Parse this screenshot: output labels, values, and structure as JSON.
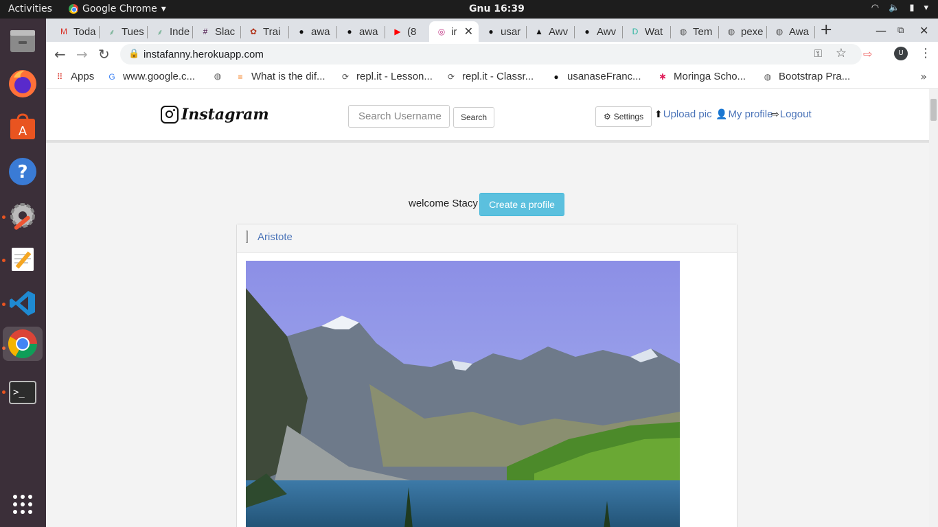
{
  "os": {
    "activities": "Activities",
    "app_name": "Google Chrome",
    "clock": "Gnu 16:39"
  },
  "tabs": [
    {
      "label": "Toda",
      "icon": "gmail-icon",
      "color": "#d93025"
    },
    {
      "label": "Tues",
      "icon": "palm-icon",
      "color": "#6a8"
    },
    {
      "label": "Inde",
      "icon": "palm-icon",
      "color": "#6a8"
    },
    {
      "label": "Slac",
      "icon": "slack-icon",
      "color": "#4a154b"
    },
    {
      "label": "Trai",
      "icon": "codewars-icon",
      "color": "#b1361e"
    },
    {
      "label": "awa",
      "icon": "github-icon",
      "color": "#111"
    },
    {
      "label": "awa",
      "icon": "github-icon",
      "color": "#111"
    },
    {
      "label": "(8",
      "icon": "youtube-icon",
      "color": "#f00"
    },
    {
      "label": "ir",
      "icon": "instagram-icon",
      "color": "#c13584"
    },
    {
      "label": "usar",
      "icon": "github-icon",
      "color": "#111"
    },
    {
      "label": "Awv",
      "icon": "awwwards-icon",
      "color": "#111"
    },
    {
      "label": "Awv",
      "icon": "github-icon",
      "color": "#111"
    },
    {
      "label": "Wat",
      "icon": "dribbble-icon",
      "color": "#2bb5a0"
    },
    {
      "label": "Tem",
      "icon": "globe-icon",
      "color": "#555"
    },
    {
      "label": "pexe",
      "icon": "globe-icon",
      "color": "#555"
    },
    {
      "label": "Awa",
      "icon": "globe-icon",
      "color": "#555"
    }
  ],
  "address": {
    "url": "instafanny.herokuapp.com"
  },
  "bookmarks": [
    {
      "label": "Apps",
      "icon": "apps-grid-icon"
    },
    {
      "label": "www.google.c...",
      "icon": "google-icon"
    },
    {
      "label": "",
      "icon": "globe-icon"
    },
    {
      "label": "What is the dif...",
      "icon": "stackoverflow-icon"
    },
    {
      "label": "repl.it - Lesson...",
      "icon": "replit-icon"
    },
    {
      "label": "repl.it - Classr...",
      "icon": "replit-icon"
    },
    {
      "label": "usanaseFranc...",
      "icon": "github-icon"
    },
    {
      "label": "Moringa Scho...",
      "icon": "slack-icon"
    },
    {
      "label": "Bootstrap Pra...",
      "icon": "globe-icon"
    }
  ],
  "profile_initial": "U",
  "site": {
    "brand": "Instagram",
    "search_placeholder": "Search Username",
    "search_button": "Search",
    "settings_button": "Settings",
    "upload_link": "Upload pic",
    "profile_link": "My profile",
    "logout_link": "Logout",
    "welcome_text": "welcome Stacy",
    "create_profile_button": "Create a profile",
    "post_author": "Aristote"
  },
  "colors": {
    "link": "#4a73b8",
    "info_button": "#5bc0de",
    "ubuntu_orange": "#e95420"
  }
}
